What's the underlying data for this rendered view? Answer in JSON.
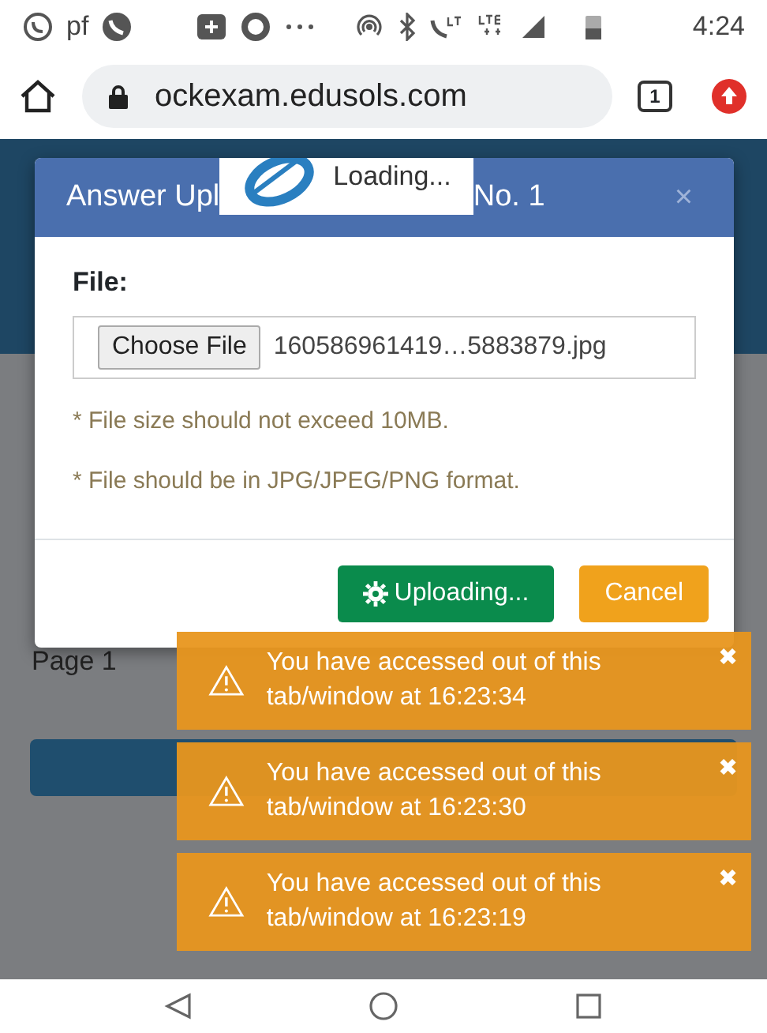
{
  "status_bar": {
    "carrier_text": "pf",
    "time": "4:24"
  },
  "browser": {
    "url": "ockexam.edusols.com",
    "tab_count": "1"
  },
  "background_page": {
    "row_label": "Page 1"
  },
  "modal": {
    "title_start": "Answer Upl",
    "title_end": "No. 1",
    "close": "×",
    "file_label": "File:",
    "choose_button": "Choose File",
    "file_name": "160586961419…5883879.jpg",
    "notes": [
      "* File size should not exceed 10MB.",
      "* File should be in JPG/JPEG/PNG format."
    ],
    "buttons": [
      {
        "kind": "uploading",
        "label": "Uploading..."
      },
      {
        "kind": "cancel",
        "label": "Cancel"
      }
    ]
  },
  "loading": {
    "text": "Loading..."
  },
  "toasts": [
    {
      "message": "You have accessed out of this tab/window at 16:23:34",
      "close": "✖"
    },
    {
      "message": "You have accessed out of this tab/window at 16:23:30",
      "close": "✖"
    },
    {
      "message": "You have accessed out of this tab/window at 16:23:19",
      "close": "✖"
    }
  ]
}
